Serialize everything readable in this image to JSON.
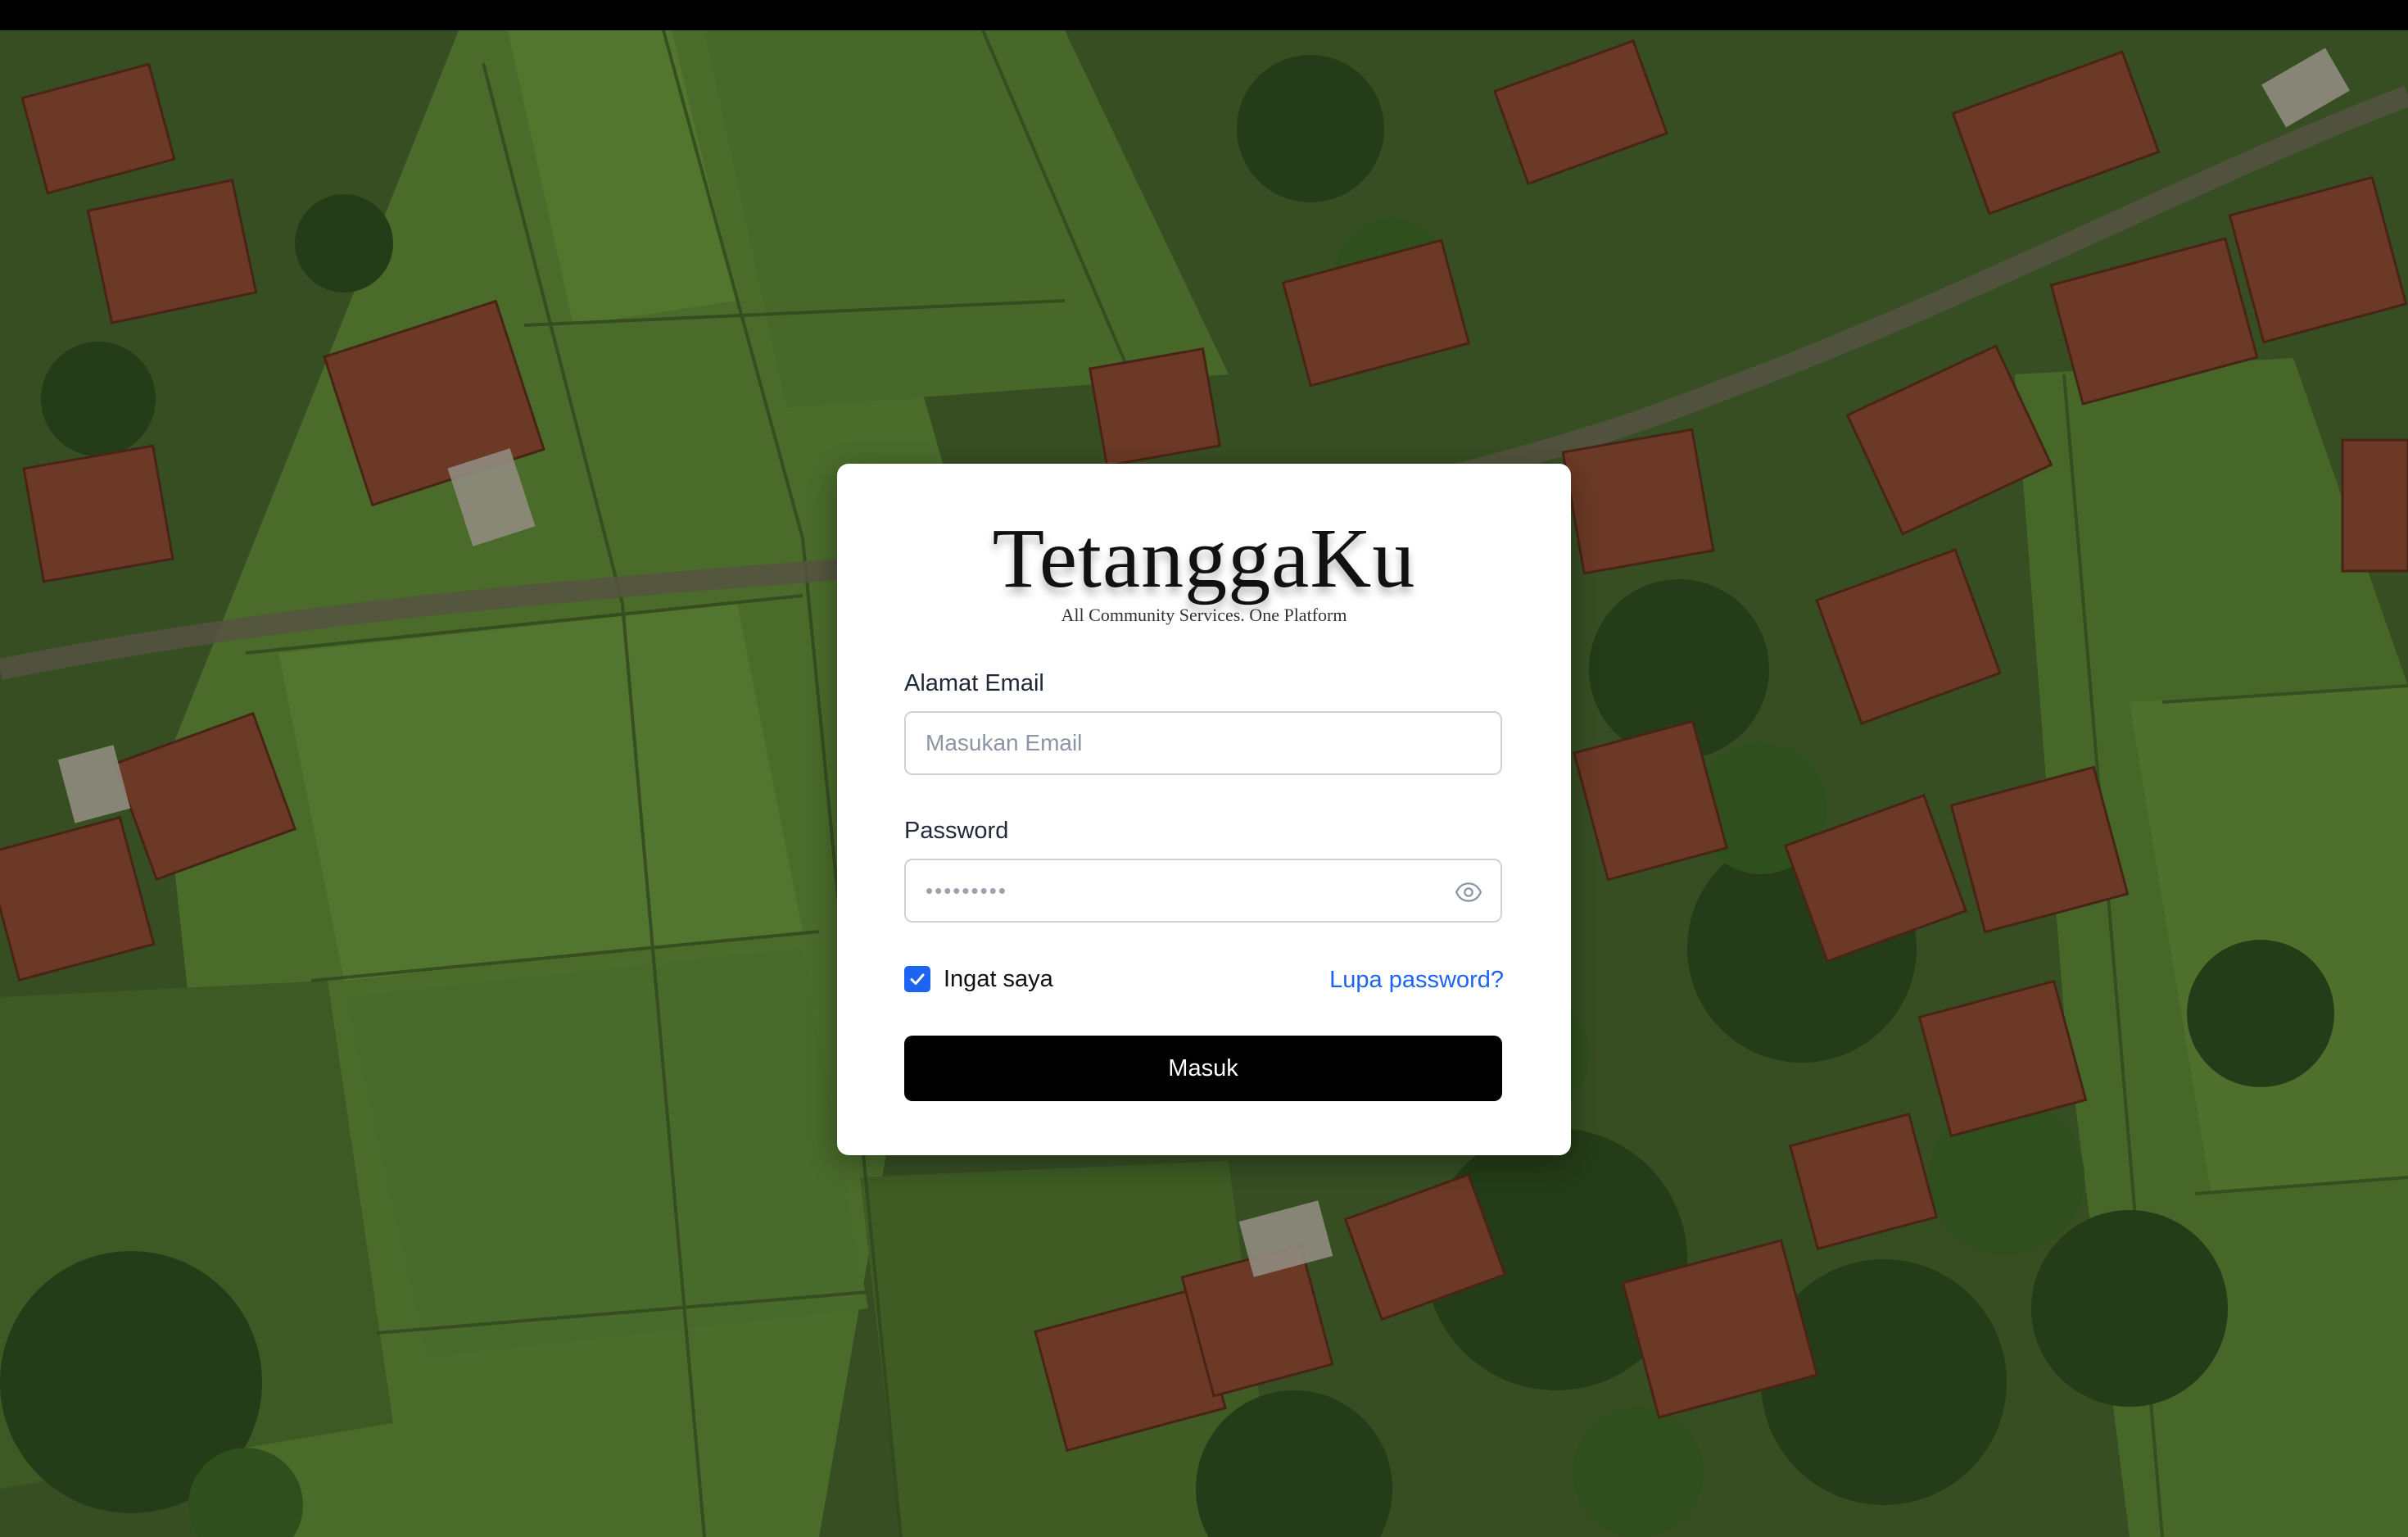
{
  "app": {
    "brand": "TetanggaKu",
    "tagline": "All Community Services. One Platform"
  },
  "form": {
    "email_label": "Alamat Email",
    "email_placeholder": "Masukan Email",
    "email_value": "",
    "password_label": "Password",
    "password_masked": "•••••••••",
    "remember_label": "Ingat saya",
    "remember_checked": true,
    "forgot_label": "Lupa password?",
    "submit_label": "Masuk"
  },
  "colors": {
    "accent": "#1d64f2",
    "button": "#000000",
    "card": "#ffffff"
  },
  "icons": {
    "password_toggle": "eye-icon",
    "checkbox": "check-icon"
  }
}
